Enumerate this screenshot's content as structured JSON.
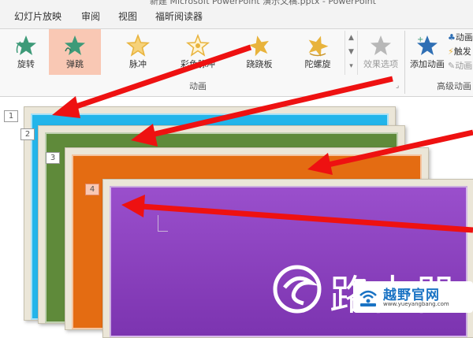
{
  "window": {
    "title": "新建 Microsoft PowerPoint 演示文稿.pptx - PowerPoint"
  },
  "tabs": [
    {
      "label": "幻灯片放映"
    },
    {
      "label": "审阅"
    },
    {
      "label": "视图"
    },
    {
      "label": "福昕阅读器"
    }
  ],
  "animation_group": {
    "label": "动画",
    "effects": [
      {
        "label": "旋转",
        "color": "#3d9a78"
      },
      {
        "label": "弹跳",
        "color": "#3d9a78"
      },
      {
        "label": "脉冲",
        "color": "#e8b33c"
      },
      {
        "label": "彩色脉冲",
        "color": "#e8b33c"
      },
      {
        "label": "跷跷板",
        "color": "#e8b33c"
      },
      {
        "label": "陀螺旋",
        "color": "#e8b33c"
      }
    ],
    "effect_options_label": "效果选项"
  },
  "advanced_group": {
    "label": "高级动画",
    "add_animation_label": "添加动画",
    "side_items": [
      {
        "label": "动画"
      },
      {
        "label": "触发"
      },
      {
        "label": "动画"
      }
    ]
  },
  "slides": [
    {
      "number": "1",
      "color": "#23b5ea"
    },
    {
      "number": "2",
      "color": "#5f8a3a"
    },
    {
      "number": "3",
      "color": "#e46c12"
    },
    {
      "number": "4",
      "color": "#8e3fbf"
    }
  ],
  "watermark": {
    "big_text": "路由器",
    "site_name": "越野官网",
    "url": "www.yueyangbang.com"
  },
  "colors": {
    "selected_effect": "#f9c8b4",
    "arrow": "#ee1111"
  }
}
